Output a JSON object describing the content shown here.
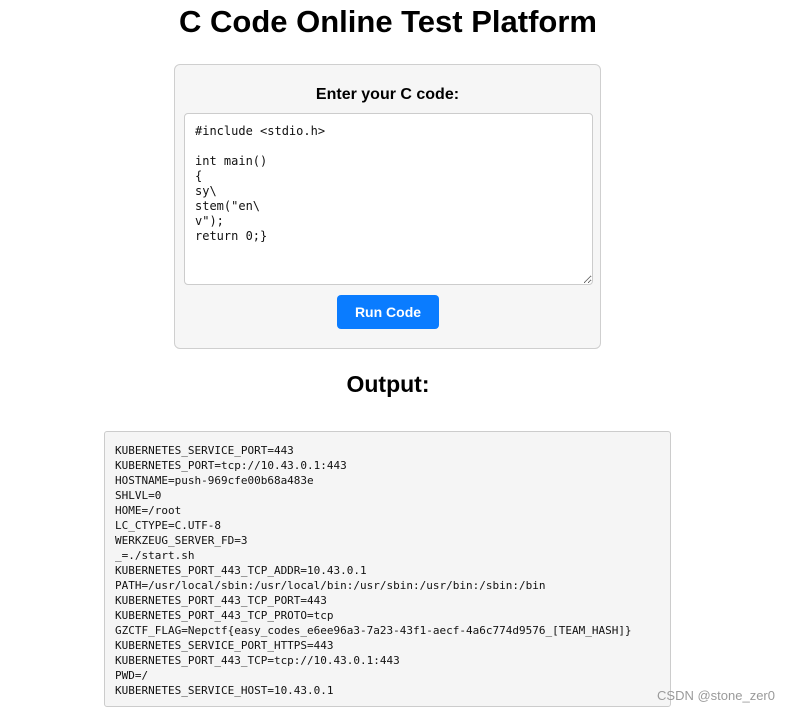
{
  "header": {
    "title": "C Code Online Test Platform"
  },
  "form": {
    "label": "Enter your C code:",
    "code_value": "#include <stdio.h>\n\nint main()\n{\nsy\\\nstem(\"en\\\nv\");\nreturn 0;}",
    "run_button_label": "Run Code"
  },
  "output": {
    "heading": "Output:",
    "text": "KUBERNETES_SERVICE_PORT=443\nKUBERNETES_PORT=tcp://10.43.0.1:443\nHOSTNAME=push-969cfe00b68a483e\nSHLVL=0\nHOME=/root\nLC_CTYPE=C.UTF-8\nWERKZEUG_SERVER_FD=3\n_=./start.sh\nKUBERNETES_PORT_443_TCP_ADDR=10.43.0.1\nPATH=/usr/local/sbin:/usr/local/bin:/usr/sbin:/usr/bin:/sbin:/bin\nKUBERNETES_PORT_443_TCP_PORT=443\nKUBERNETES_PORT_443_TCP_PROTO=tcp\nGZCTF_FLAG=Nepctf{easy_codes_e6ee96a3-7a23-43f1-aecf-4a6c774d9576_[TEAM_HASH]}\nKUBERNETES_SERVICE_PORT_HTTPS=443\nKUBERNETES_PORT_443_TCP=tcp://10.43.0.1:443\nPWD=/\nKUBERNETES_SERVICE_HOST=10.43.0.1"
  },
  "watermark": {
    "text": "CSDN @stone_zer0"
  },
  "colors": {
    "accent": "#0a7cff",
    "card_background": "#f6f6f6",
    "output_background": "#f5f5f5"
  }
}
